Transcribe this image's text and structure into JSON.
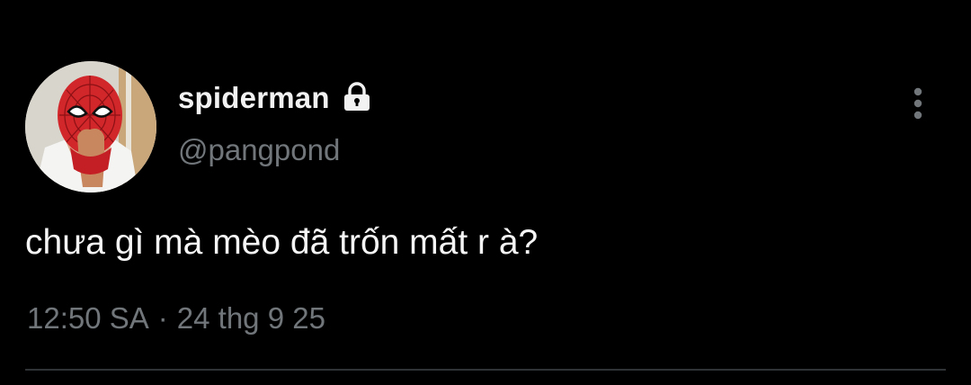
{
  "tweet": {
    "display_name": "spiderman",
    "handle": "@pangpond",
    "text": "chưa gì mà mèo đã trốn mất r à?",
    "time": "12:50 SA",
    "separator": "·",
    "date": "24 thg 9 25"
  },
  "icons": {
    "lock": "lock-icon",
    "more": "more-vertical-icon"
  },
  "colors": {
    "background": "#000000",
    "primary_text": "#e7e9ea",
    "secondary_text": "#71767b",
    "divider": "#2f3336"
  }
}
